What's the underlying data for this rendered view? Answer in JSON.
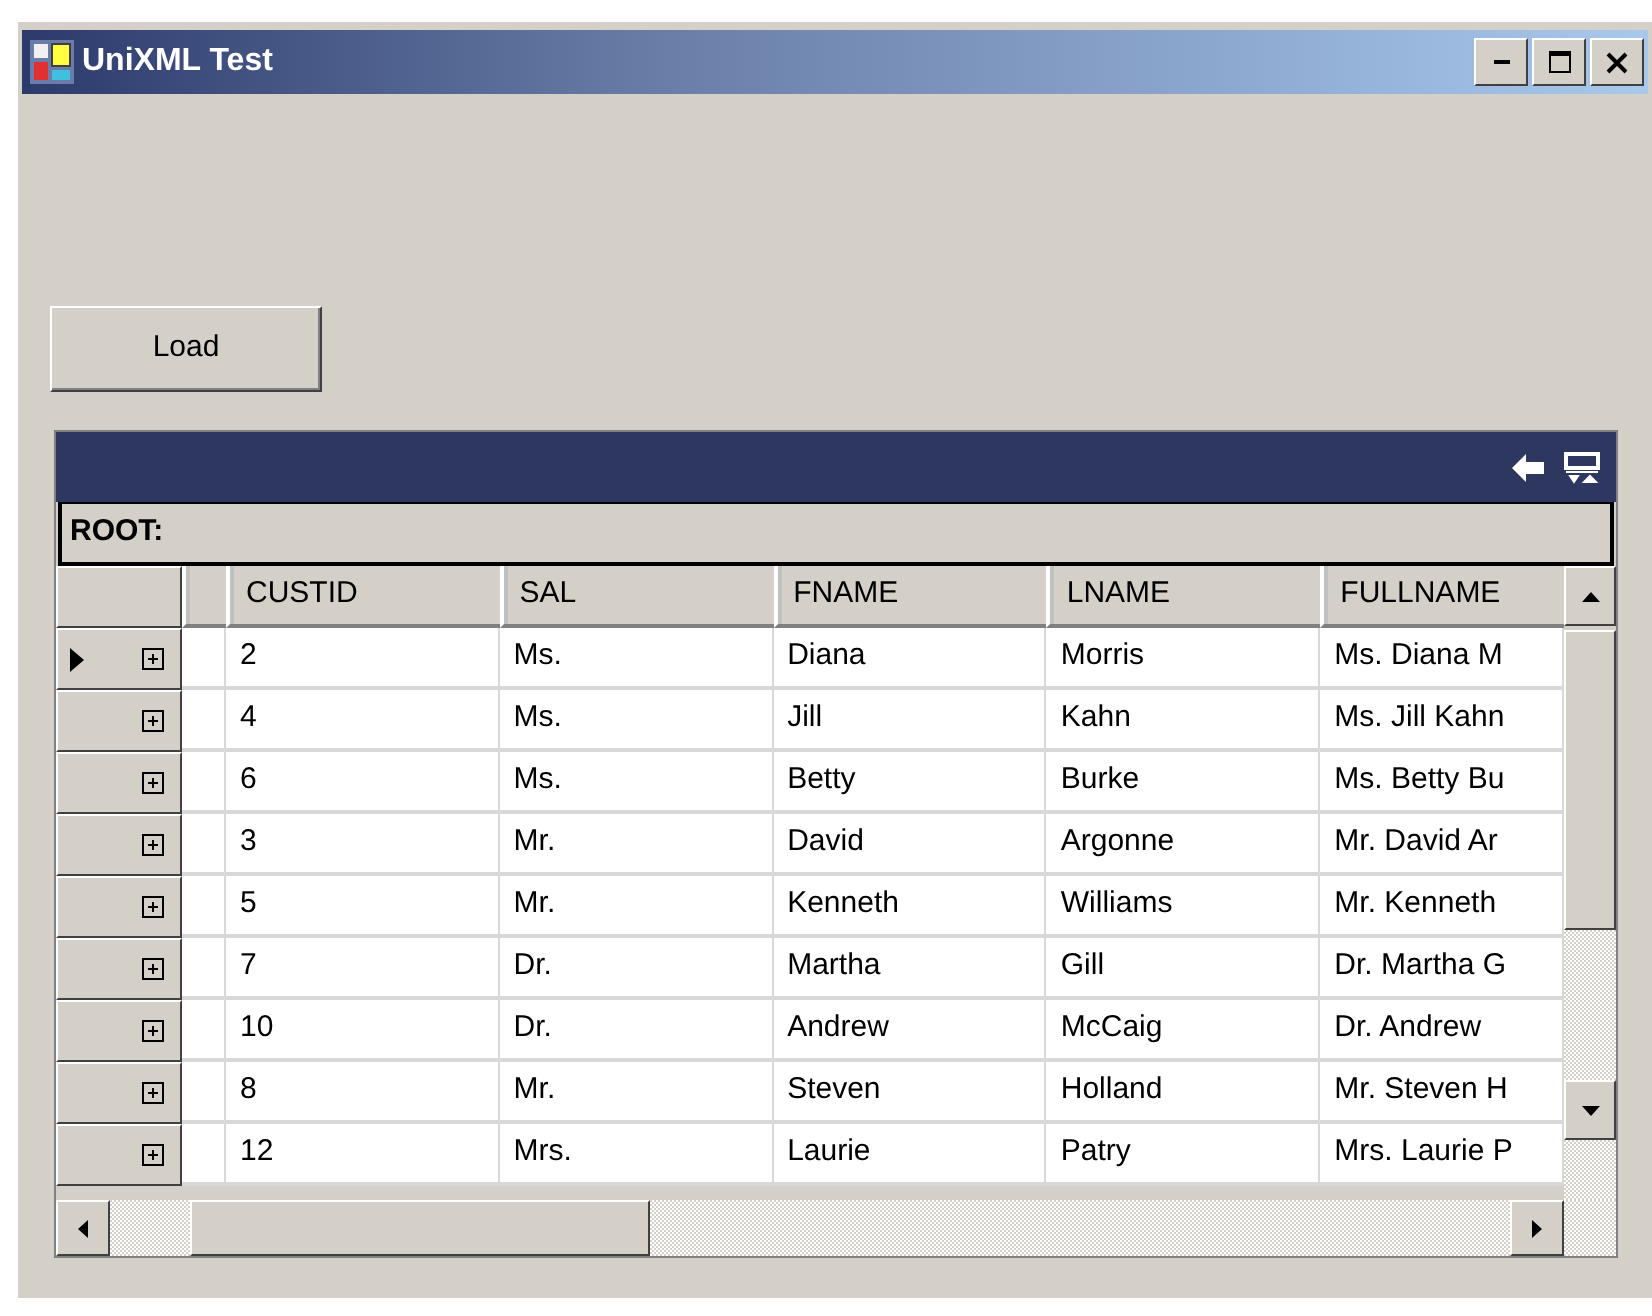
{
  "window": {
    "title": "UniXML Test"
  },
  "load_button": {
    "label": "Load"
  },
  "grid": {
    "caption_path": "ROOT:",
    "columns": [
      "CUSTID",
      "SAL",
      "FNAME",
      "LNAME",
      "FULLNAME"
    ],
    "rows": [
      {
        "current": true,
        "expanded": false,
        "cells": [
          "2",
          "Ms.",
          "Diana",
          "Morris",
          "Ms. Diana M"
        ]
      },
      {
        "current": false,
        "expanded": false,
        "cells": [
          "4",
          "Ms.",
          "Jill",
          "Kahn",
          "Ms. Jill Kahn"
        ]
      },
      {
        "current": false,
        "expanded": false,
        "cells": [
          "6",
          "Ms.",
          "Betty",
          "Burke",
          "Ms. Betty Bu"
        ]
      },
      {
        "current": false,
        "expanded": false,
        "cells": [
          "3",
          "Mr.",
          "David",
          "Argonne",
          "Mr. David Ar"
        ]
      },
      {
        "current": false,
        "expanded": false,
        "cells": [
          "5",
          "Mr.",
          "Kenneth",
          "Williams",
          "Mr. Kenneth"
        ]
      },
      {
        "current": false,
        "expanded": false,
        "cells": [
          "7",
          "Dr.",
          "Martha",
          "Gill",
          "Dr. Martha G"
        ]
      },
      {
        "current": false,
        "expanded": false,
        "cells": [
          "10",
          "Dr.",
          "Andrew",
          "McCaig",
          "Dr. Andrew"
        ]
      },
      {
        "current": false,
        "expanded": false,
        "cells": [
          "8",
          "Mr.",
          "Steven",
          "Holland",
          "Mr. Steven H"
        ]
      },
      {
        "current": false,
        "expanded": false,
        "cells": [
          "12",
          "Mrs.",
          "Laurie",
          "Patry",
          "Mrs. Laurie P"
        ]
      }
    ]
  }
}
